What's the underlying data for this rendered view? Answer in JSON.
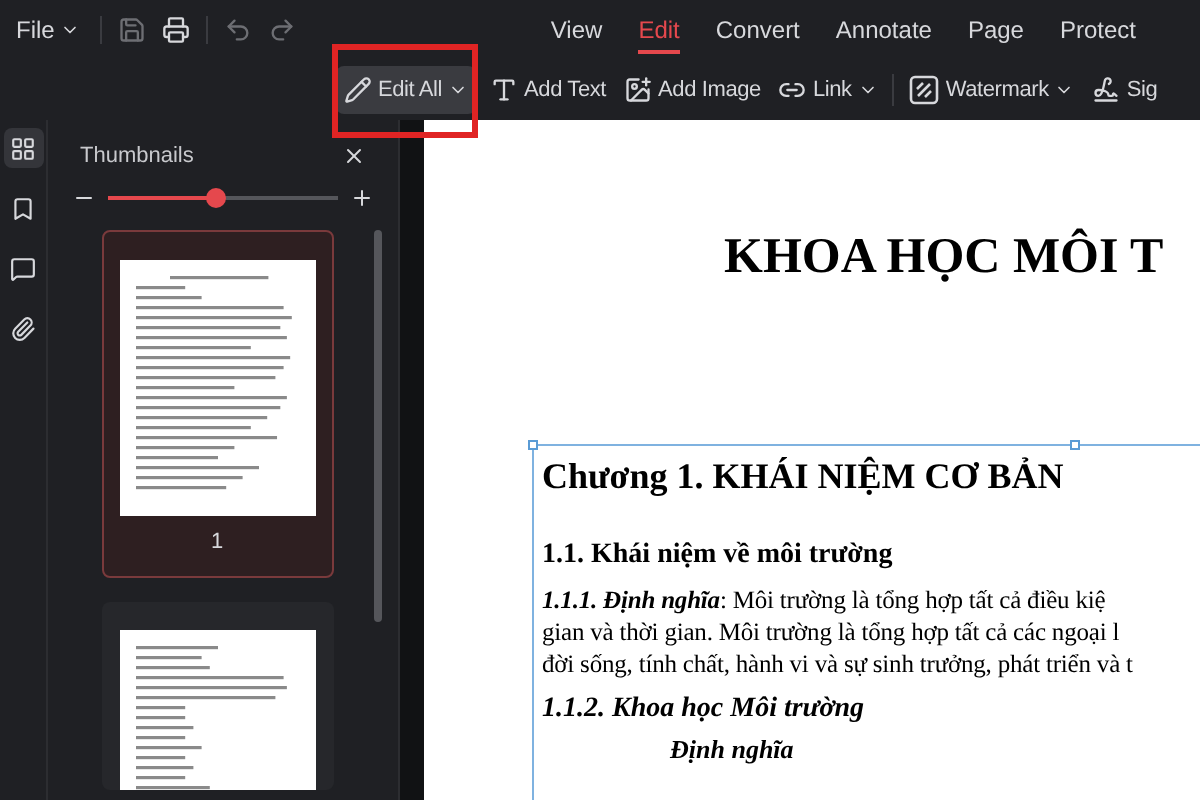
{
  "menu": {
    "file": "File"
  },
  "tabs": [
    {
      "label": "View",
      "selected": false
    },
    {
      "label": "Edit",
      "selected": true
    },
    {
      "label": "Convert",
      "selected": false
    },
    {
      "label": "Annotate",
      "selected": false
    },
    {
      "label": "Page",
      "selected": false
    },
    {
      "label": "Protect",
      "selected": false
    }
  ],
  "toolbar": [
    {
      "kind": "edit",
      "label": "Edit All",
      "dropdown": true,
      "selected": true
    },
    {
      "kind": "text",
      "label": "Add Text",
      "dropdown": false,
      "selected": false
    },
    {
      "kind": "image",
      "label": "Add Image",
      "dropdown": false,
      "selected": false
    },
    {
      "kind": "link",
      "label": "Link",
      "dropdown": true,
      "selected": false
    },
    {
      "kind": "watermark",
      "label": "Watermark",
      "dropdown": true,
      "selected": false
    },
    {
      "kind": "sign",
      "label": "Sig",
      "dropdown": false,
      "selected": false
    }
  ],
  "sidebar": {
    "items": [
      {
        "kind": "thumbnails",
        "selected": true
      },
      {
        "kind": "bookmark",
        "selected": false
      },
      {
        "kind": "comment",
        "selected": false
      },
      {
        "kind": "attachment",
        "selected": false
      }
    ]
  },
  "thumbnails": {
    "title": "Thumbnails",
    "zoom": {
      "level": 0.47
    },
    "pages": [
      {
        "label": "1",
        "selected": true
      },
      {
        "selected": false
      }
    ]
  },
  "document": {
    "title": "KHOA HỌC MÔI T",
    "chapter": "Chương 1. KHÁI NIỆM CƠ BẢN",
    "section": "1.1. Khái niệm về môi trường",
    "paragraph": {
      "lead": "1.1.1. Định nghĩa",
      "lines": [
        ": Môi trường là tổng hợp tất cả điều kiệ",
        "gian và thời gian. Môi trường là tổng hợp tất cả các ngoại l",
        "đời sống, tính chất, hành vi và sự sinh trưởng, phát triển và t"
      ]
    },
    "subsection": "1.1.2. Khoa học Môi trường",
    "subheading": "Định nghĩa"
  }
}
